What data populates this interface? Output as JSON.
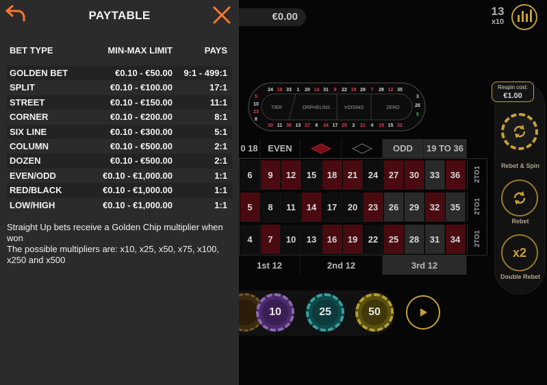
{
  "paytable": {
    "title": "PAYTABLE",
    "columns": {
      "bet_type": "BET TYPE",
      "limit": "MIN-MAX LIMIT",
      "pays": "PAYS"
    },
    "rows": [
      {
        "type": "GOLDEN BET",
        "limit": "€0.10 - €50.00",
        "pays": "9:1 - 499:1"
      },
      {
        "type": "SPLIT",
        "limit": "€0.10 - €100.00",
        "pays": "17:1"
      },
      {
        "type": "STREET",
        "limit": "€0.10 - €150.00",
        "pays": "11:1"
      },
      {
        "type": "CORNER",
        "limit": "€0.10 - €200.00",
        "pays": "8:1"
      },
      {
        "type": "SIX LINE",
        "limit": "€0.10 - €300.00",
        "pays": "5:1"
      },
      {
        "type": "COLUMN",
        "limit": "€0.10 - €500.00",
        "pays": "2:1"
      },
      {
        "type": "DOZEN",
        "limit": "€0.10 - €500.00",
        "pays": "2:1"
      },
      {
        "type": "EVEN/ODD",
        "limit": "€0.10 - €1,000.00",
        "pays": "1:1"
      },
      {
        "type": "RED/BLACK",
        "limit": "€0.10 - €1,000.00",
        "pays": "1:1"
      },
      {
        "type": "LOW/HIGH",
        "limit": "€0.10 - €1,000.00",
        "pays": "1:1"
      }
    ],
    "note_line1": "Straight Up bets receive a Golden Chip multiplier when won",
    "note_line2": "The possible multipliers are: x10, x25, x50, x75, x100, x250 and x500",
    "back_icon": "back-arrow-icon",
    "close_icon": "close-x-icon",
    "accent_color": "#ff7a2e"
  },
  "game": {
    "balance": "€0.00",
    "round_count": "13",
    "round_multiplier": "x10",
    "racetrack": {
      "top_numbers": [
        "24",
        "18",
        "33",
        "1",
        "20",
        "14",
        "31",
        "9",
        "22",
        "18",
        "29",
        "7",
        "28",
        "12",
        "35"
      ],
      "bottom_numbers": [
        "30",
        "11",
        "36",
        "13",
        "27",
        "6",
        "34",
        "17",
        "25",
        "2",
        "21",
        "4",
        "19",
        "15",
        "32"
      ],
      "left_numbers": [
        "5",
        "10",
        "23",
        "8"
      ],
      "right_numbers": [
        "3",
        "26",
        "0"
      ],
      "sections": [
        "TIER",
        "ORPHELINS",
        "VOISINS",
        "ZERO"
      ]
    },
    "table": {
      "top_labels": [
        "0 18",
        "EVEN",
        "",
        "",
        "ODD",
        "19 TO 36"
      ],
      "rows": [
        [
          "6",
          "9",
          "12",
          "15",
          "18",
          "21",
          "24",
          "27",
          "30",
          "33",
          "36"
        ],
        [
          "5",
          "8",
          "11",
          "14",
          "17",
          "20",
          "23",
          "26",
          "29",
          "32",
          "35"
        ],
        [
          "4",
          "7",
          "10",
          "13",
          "16",
          "19",
          "22",
          "25",
          "28",
          "31",
          "34"
        ]
      ],
      "column_label": "2TO1",
      "dozens": [
        "1st 12",
        "2nd 12",
        "3rd 12"
      ]
    },
    "respin_cost_label": "Respin cost:",
    "respin_cost": "€1.00",
    "actions": [
      {
        "label": "Rebet & Spin",
        "icon": "rebet-spin-icon"
      },
      {
        "label": "Rebet",
        "icon": "rebet-icon"
      },
      {
        "label": "Double Rebet",
        "icon": "double-rebet-icon",
        "glyph": "x2"
      }
    ],
    "chips": [
      "10",
      "25",
      "50"
    ],
    "play_icon": "play-icon"
  }
}
